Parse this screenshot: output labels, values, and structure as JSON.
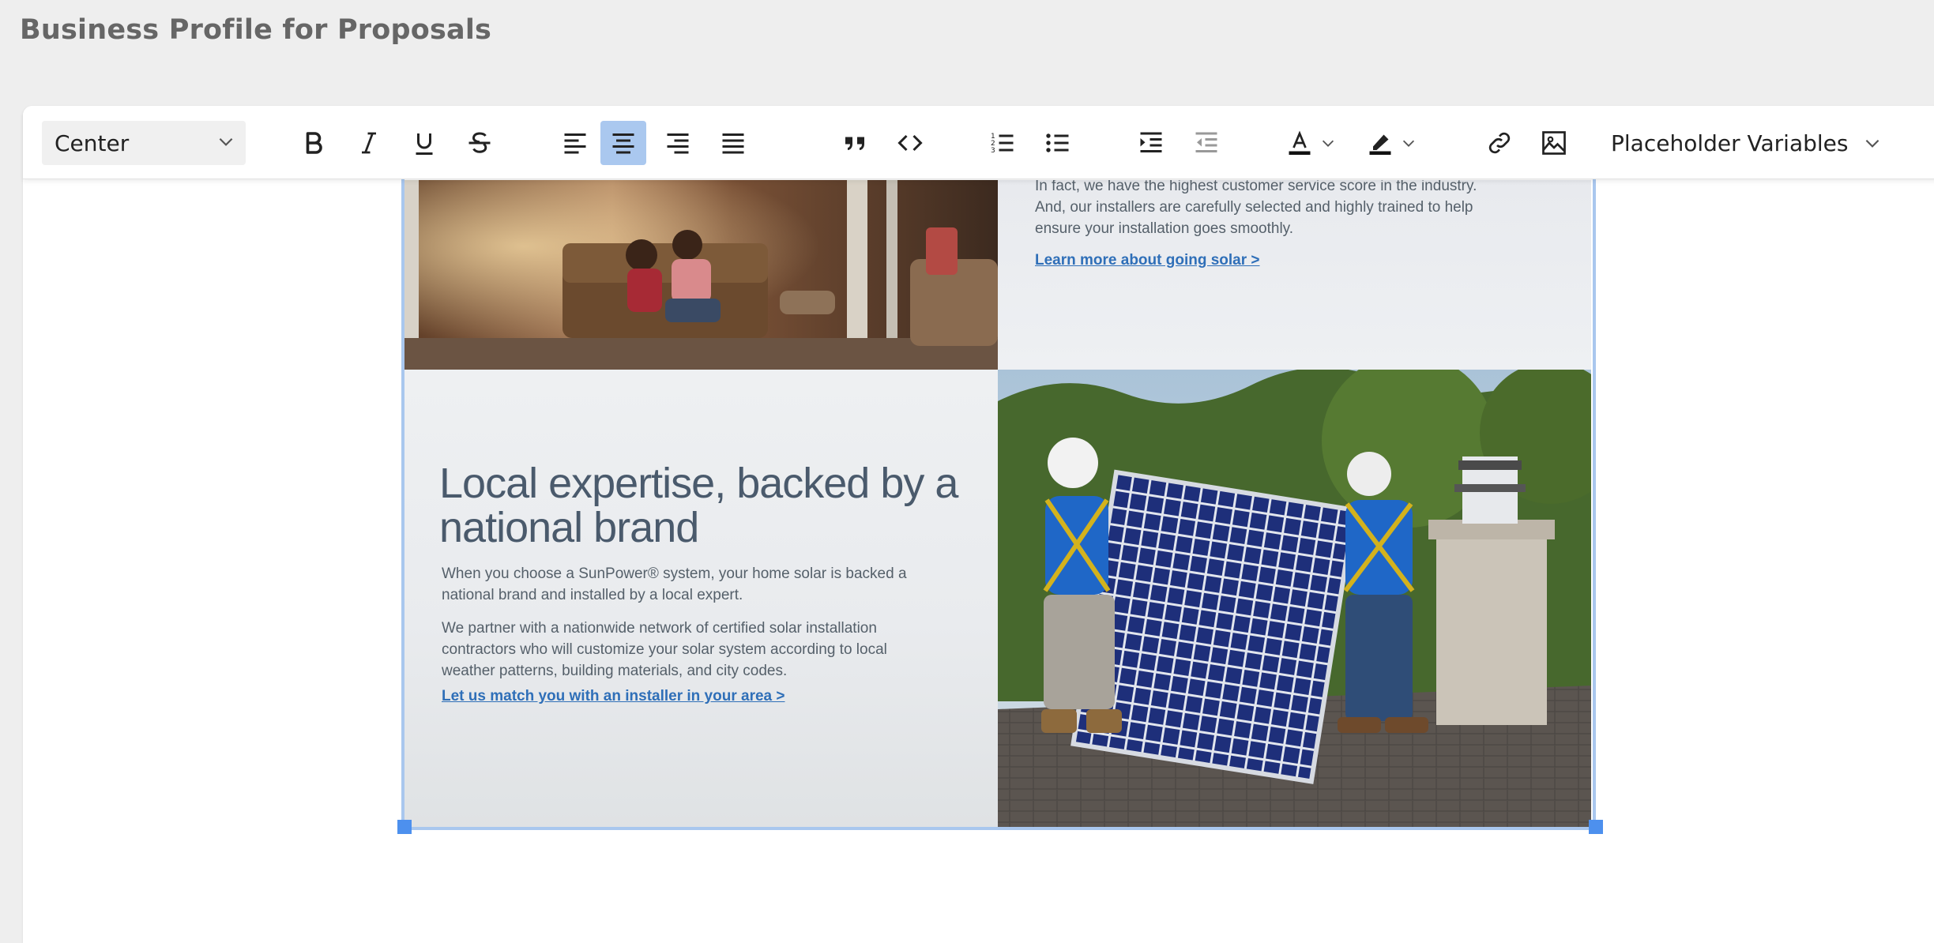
{
  "page": {
    "title": "Business Profile for Proposals"
  },
  "toolbar": {
    "block_align_value": "Center",
    "placeholder_variables_label": "Placeholder Variables",
    "active_alignment": "align-center",
    "colors": {
      "active_bg": "#aac8ef",
      "icon": "#222222",
      "disabled_icon": "#999999"
    }
  },
  "content": {
    "top_right_lines": [
      "In fact, we have the highest customer service score in the industry.",
      "And, our installers are carefully selected and highly trained to help",
      "ensure your installation goes smoothly."
    ],
    "top_right_link": "Learn more about going solar >",
    "heading_line1": "Local expertise, backed by a",
    "heading_line2": "national brand",
    "para1_line1": "When you choose a SunPower® system, your home solar is backed a",
    "para1_line2": "national brand and installed by a local expert.",
    "para2_line1": "We partner with a nationwide network of certified solar installation",
    "para2_line2": "contractors who will customize your solar system according to local",
    "para2_line3": "weather patterns, building materials, and city codes.",
    "link2": "Let us match you with an installer in your area >"
  }
}
